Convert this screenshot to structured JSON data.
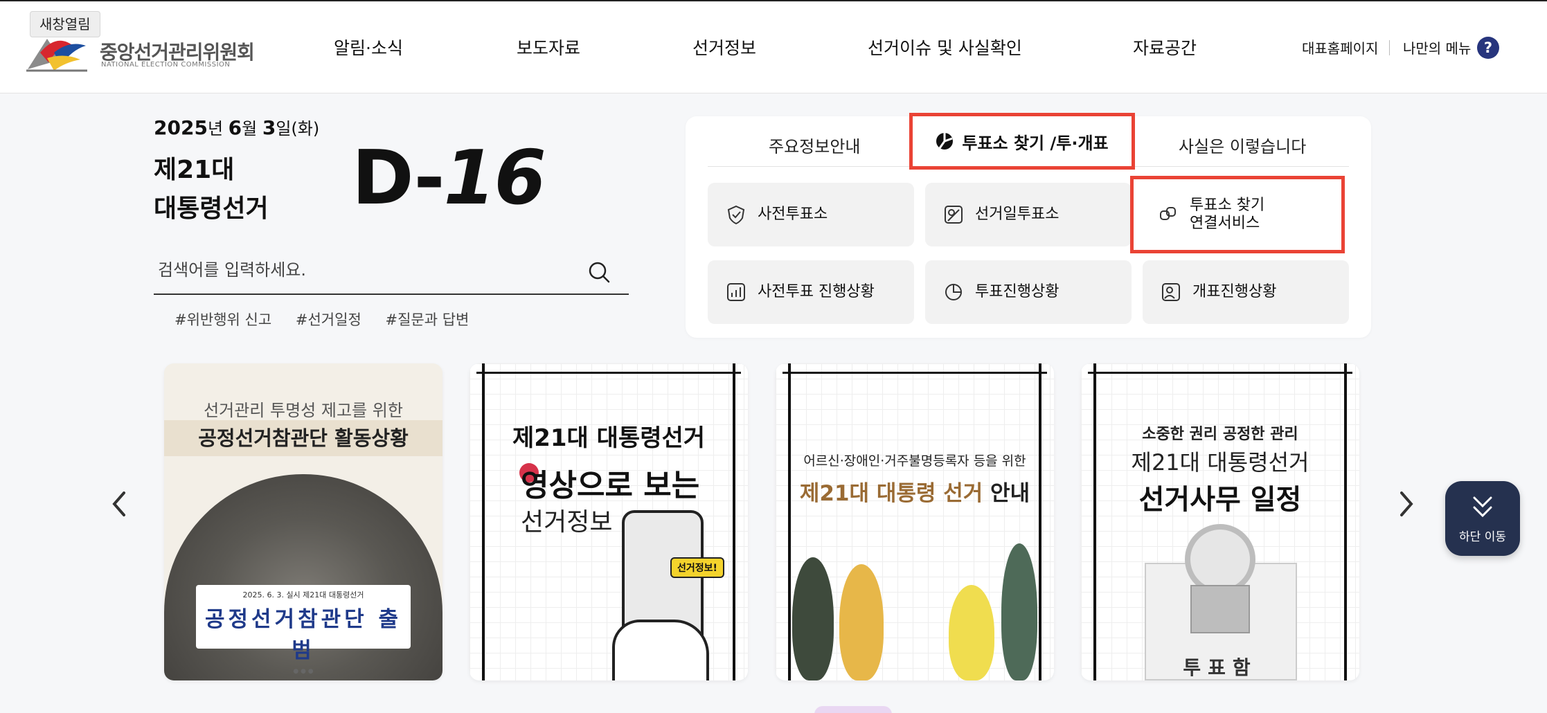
{
  "tooltip": {
    "text": "새창열림"
  },
  "logo": {
    "name_ko": "중앙선거관리위원회",
    "name_en": "NATIONAL ELECTION COMMISSION"
  },
  "nav": {
    "items": [
      "알림·소식",
      "보도자료",
      "선거정보",
      "선거이슈 및 사실확인",
      "자료공간"
    ]
  },
  "utility": {
    "home": "대표홈페이지",
    "my_menu": "나만의 메뉴",
    "help": "?"
  },
  "election": {
    "date_part1": "2025",
    "date_part2": "년 ",
    "date_part3": "6",
    "date_part4": "월 ",
    "date_part5": "3",
    "date_part6": "일(화)",
    "title_line1": "제21대",
    "title_line2": "대통령선거",
    "dday_prefix": "D-",
    "dday_number": "16"
  },
  "search": {
    "placeholder": "검색어를 입력하세요.",
    "hashtags": [
      "#위반행위 신고",
      "#선거일정",
      "#질문과 답변"
    ]
  },
  "panel": {
    "tabs": [
      "주요정보안내",
      "투표소 찾기 /투·개표",
      "사실은 이렇습니다"
    ],
    "active_tab": 1,
    "tiles": [
      {
        "label": "사전투표소",
        "icon": "check-shield-icon"
      },
      {
        "label": "선거일투표소",
        "icon": "map-pin-icon"
      },
      {
        "label": "투표소 찾기\n연결서비스",
        "icon": "link-service-icon"
      },
      {
        "label": "사전투표 진행상황",
        "icon": "bar-chart-icon"
      },
      {
        "label": "투표진행상황",
        "icon": "pie-chart-icon"
      },
      {
        "label": "개표진행상황",
        "icon": "person-chart-icon"
      }
    ]
  },
  "cards": [
    {
      "subtitle": "선거관리 투명성 제고를 위한",
      "title": "공정선거참관단 활동상황",
      "banner_small": "2025. 6. 3. 실시 제21대 대통령선거",
      "banner_large": "공정선거참관단 출범"
    },
    {
      "line1": "제21대 대통령선거",
      "line2": "영상으로 보는",
      "line3": "선거정보",
      "badge": "선거정보!"
    },
    {
      "line1": "어르신·장애인·거주불명등록자 등을 위한",
      "line2_hl": "제21대 대통령 선거",
      "line2_rest": " 안내"
    },
    {
      "line1": "소중한 권리 공정한 관리",
      "line2": "제21대 대통령선거",
      "line3": "선거사무 일정",
      "box_label": "투표함"
    }
  ],
  "float_button": {
    "label": "하단 이동"
  },
  "colors": {
    "accent_red": "#ea4335",
    "navy": "#27357d",
    "float_bg": "#25314f"
  }
}
